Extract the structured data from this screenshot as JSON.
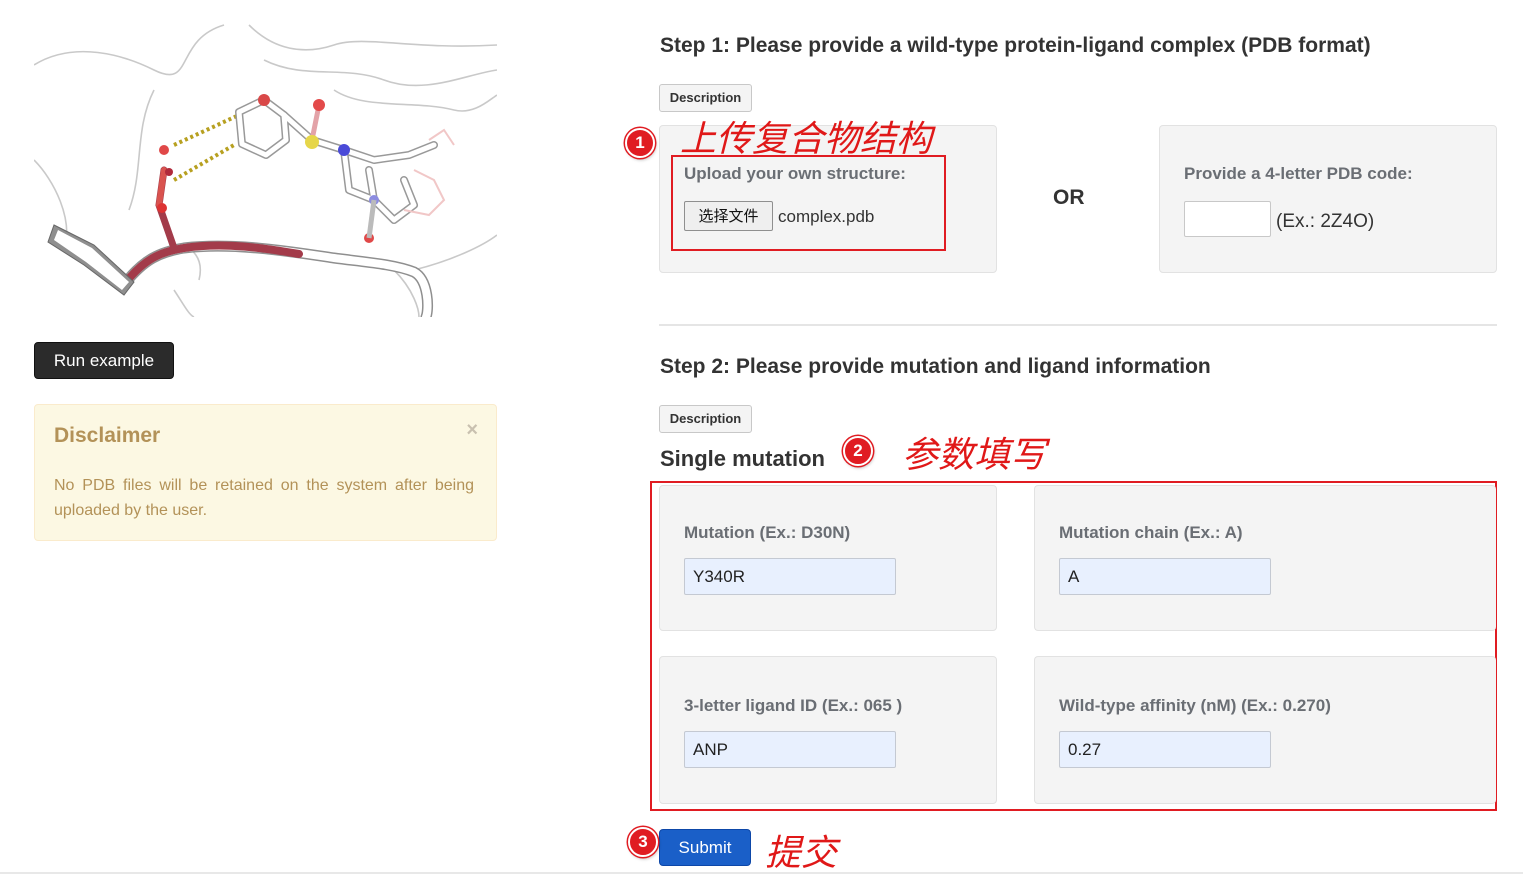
{
  "left": {
    "run_example": "Run example",
    "disclaimer": {
      "title": "Disclaimer",
      "close": "×",
      "body": "No PDB files will be retained on the system after being uploaded by the user."
    }
  },
  "step1": {
    "title": "Step 1: Please provide a wild-type protein-ligand complex (PDB format)",
    "description_button": "Description",
    "upload": {
      "label": "Upload your own structure:",
      "choose_button": "选择文件",
      "file_name": "complex.pdb"
    },
    "or": "OR",
    "pdb": {
      "label": "Provide a 4-letter PDB code:",
      "value": "",
      "example": "(Ex.: 2Z4O)"
    }
  },
  "step2": {
    "title": "Step 2: Please provide mutation and ligand information",
    "description_button": "Description",
    "subtitle": "Single mutation",
    "fields": {
      "mutation": {
        "label": "Mutation (Ex.: D30N)",
        "value": "Y340R"
      },
      "chain": {
        "label": "Mutation chain (Ex.: A)",
        "value": "A"
      },
      "ligand": {
        "label": "3-letter ligand ID (Ex.: 065 )",
        "value": "ANP"
      },
      "affinity": {
        "label": "Wild-type affinity (nM) (Ex.: 0.270)",
        "value": "0.27"
      }
    },
    "submit": "Submit"
  },
  "annotations": {
    "n1": "1",
    "t1": "上传复合物结构",
    "n2": "2",
    "t2": "参数填写",
    "n3": "3",
    "t3": "提交"
  },
  "colors": {
    "annotation_red": "#e01c22",
    "submit_blue": "#1a5fc8",
    "run_example_dark": "#2b2b2b",
    "disclaimer_bg": "#fcf8e3"
  }
}
